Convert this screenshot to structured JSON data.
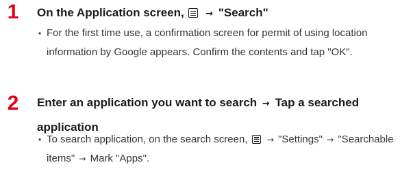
{
  "steps": [
    {
      "number": "1",
      "title_prefix": "On the Application screen,",
      "menu_icon": "menu-icon",
      "title_arrow": "→",
      "title_suffix": "\"Search\"",
      "notes": [
        {
          "bullet": "•",
          "text": "For the first time use, a confirmation screen for permit of using location information by Google appears. Confirm the contents and tap \"OK\"."
        }
      ]
    },
    {
      "number": "2",
      "title_part1": "Enter an application you want to search",
      "title_arrow": "→",
      "title_part2": "Tap a searched application",
      "notes": [
        {
          "bullet": "•",
          "text_part1": "To search application, on the search screen,",
          "menu_icon": "menu-icon",
          "arrow": "→",
          "text_part2": "\"Settings\"",
          "text_part3": "\"Searchable items\"",
          "text_part4": "Mark \"Apps\"."
        }
      ]
    }
  ],
  "colors": {
    "step_number": "#e2001a",
    "title": "#1a1a1a",
    "body": "#333333"
  }
}
